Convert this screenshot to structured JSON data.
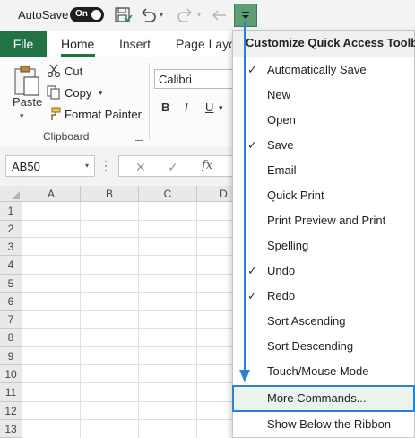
{
  "qat": {
    "autosave_label": "AutoSave",
    "toggle_text": "On"
  },
  "tabs": {
    "file": "File",
    "home": "Home",
    "insert": "Insert",
    "page_layout": "Page Layou"
  },
  "ribbon": {
    "paste": "Paste",
    "cut": "Cut",
    "copy": "Copy",
    "format_painter": "Format Painter",
    "clipboard": "Clipboard",
    "font_name": "Calibri",
    "bold": "B",
    "italic": "I",
    "underline": "U"
  },
  "formula_bar": {
    "name_box": "AB50",
    "cancel": "✕",
    "enter": "✓",
    "fx": "fx"
  },
  "grid": {
    "columns": [
      "A",
      "B",
      "C",
      "D"
    ],
    "rows": [
      "1",
      "2",
      "3",
      "4",
      "5",
      "6",
      "7",
      "8",
      "9",
      "10",
      "11",
      "12",
      "13"
    ]
  },
  "menu": {
    "title": "Customize Quick Access Toolbar",
    "items": [
      {
        "label": "Automatically Save",
        "checked": true
      },
      {
        "label": "New",
        "checked": false
      },
      {
        "label": "Open",
        "checked": false
      },
      {
        "label": "Save",
        "checked": true
      },
      {
        "label": "Email",
        "checked": false
      },
      {
        "label": "Quick Print",
        "checked": false
      },
      {
        "label": "Print Preview and Print",
        "checked": false
      },
      {
        "label": "Spelling",
        "checked": false
      },
      {
        "label": "Undo",
        "checked": true
      },
      {
        "label": "Redo",
        "checked": true
      },
      {
        "label": "Sort Ascending",
        "checked": false
      },
      {
        "label": "Sort Descending",
        "checked": false
      },
      {
        "label": "Touch/Mouse Mode",
        "checked": false
      },
      {
        "label": "More Commands...",
        "checked": false
      },
      {
        "label": "Show Below the Ribbon",
        "checked": false
      }
    ]
  },
  "colors": {
    "excel_green": "#217346",
    "highlight_border": "#2e7fd6",
    "arrow": "#2e7fd6"
  }
}
